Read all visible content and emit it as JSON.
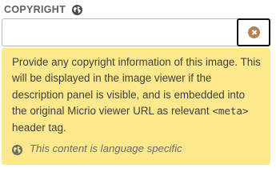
{
  "field": {
    "label": "COPYRIGHT",
    "label_icon": "globe-icon",
    "input_value": "",
    "input_placeholder": "",
    "clear_icon": "clear-icon"
  },
  "help": {
    "text_before_code": "Provide any copyright information of this image. This will be displayed in the image viewer if the description panel is visible, and is embedded into the original Micrio viewer URL as relevant ",
    "code": "<meta>",
    "text_after_code": " header tag.",
    "language_note": "This content is language specific",
    "language_icon": "globe-icon"
  },
  "colors": {
    "help_background": "#fde98c",
    "clear_icon": "#b5835a",
    "label": "#5f5f5f"
  }
}
